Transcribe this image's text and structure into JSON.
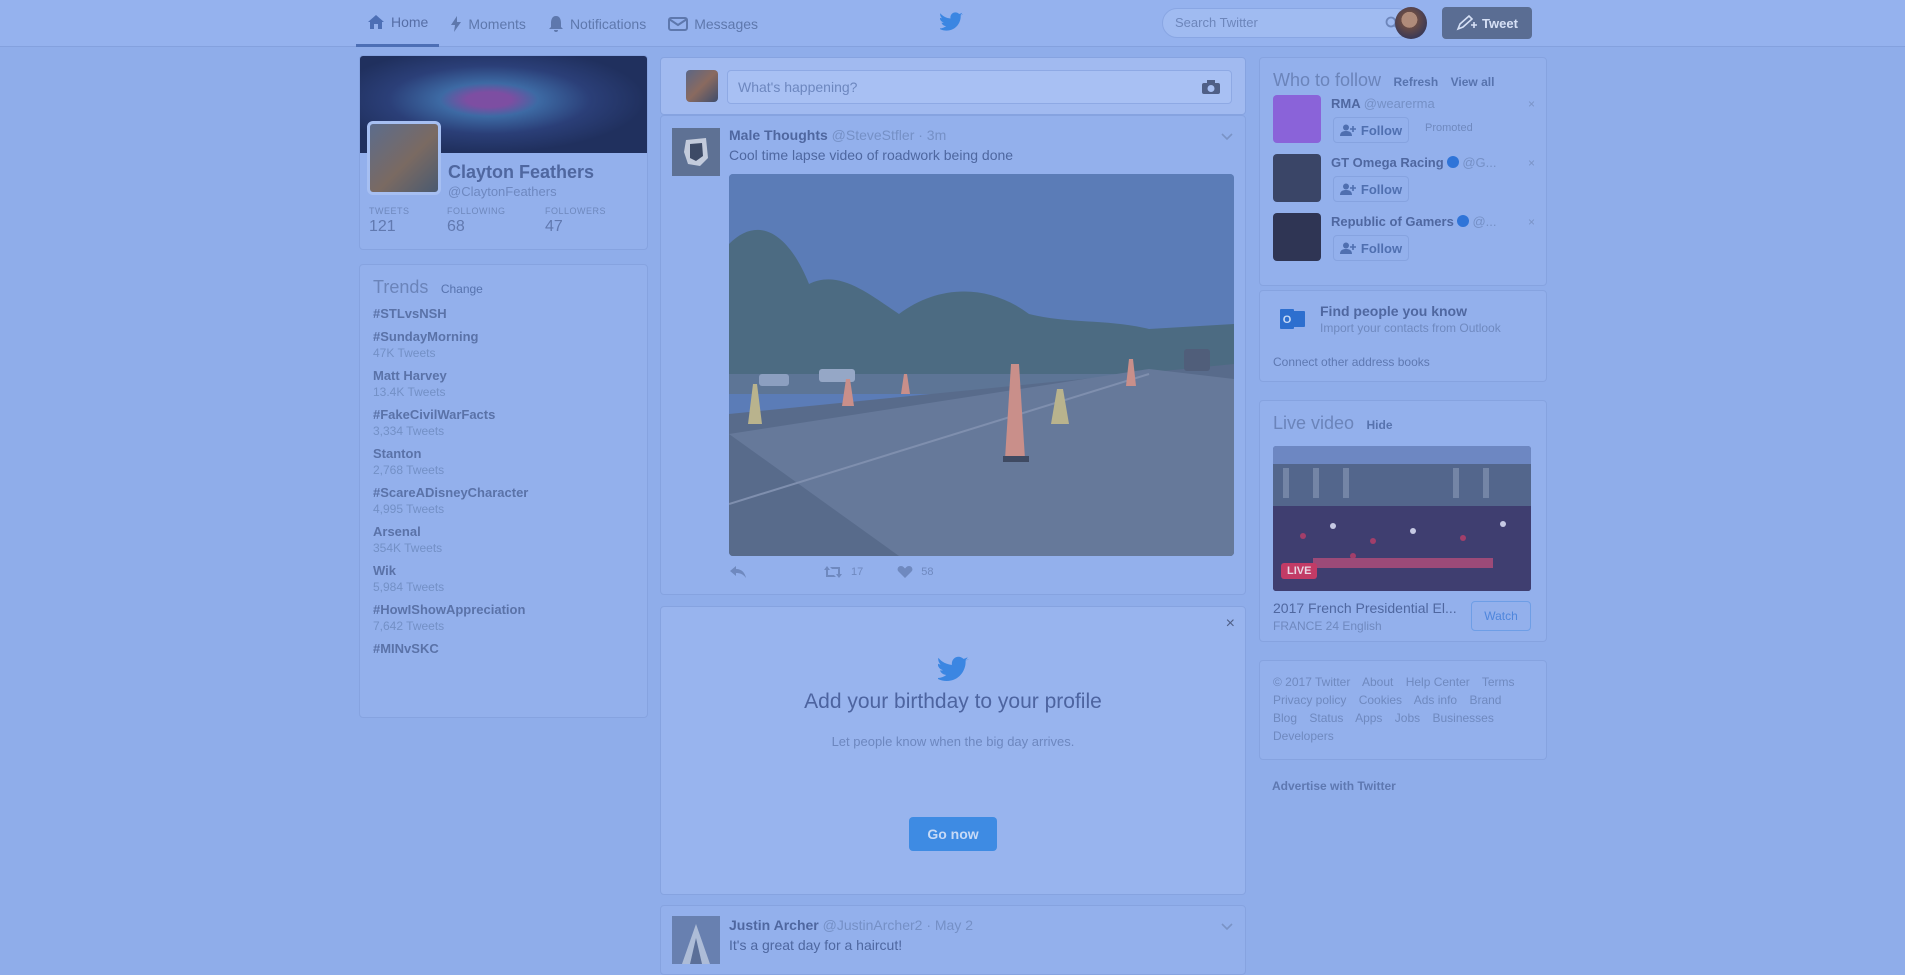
{
  "nav": {
    "items": [
      {
        "label": "Home",
        "icon": "home-icon"
      },
      {
        "label": "Moments",
        "icon": "lightning-icon"
      },
      {
        "label": "Notifications",
        "icon": "bell-icon"
      },
      {
        "label": "Messages",
        "icon": "envelope-icon"
      }
    ],
    "search_placeholder": "Search Twitter",
    "tweet_button": "Tweet"
  },
  "profile": {
    "name": "Clayton Feathers",
    "handle": "@ClaytonFeathers",
    "stats": [
      {
        "label": "TWEETS",
        "value": "121"
      },
      {
        "label": "FOLLOWING",
        "value": "68"
      },
      {
        "label": "FOLLOWERS",
        "value": "47"
      }
    ]
  },
  "trends": {
    "title": "Trends",
    "change_label": "Change",
    "items": [
      {
        "name": "#STLvsNSH",
        "count": ""
      },
      {
        "name": "#SundayMorning",
        "count": "47K Tweets"
      },
      {
        "name": "Matt Harvey",
        "count": "13.4K Tweets"
      },
      {
        "name": "#FakeCivilWarFacts",
        "count": "3,334 Tweets"
      },
      {
        "name": "Stanton",
        "count": "2,768 Tweets"
      },
      {
        "name": "#ScareADisneyCharacter",
        "count": "4,995 Tweets"
      },
      {
        "name": "Arsenal",
        "count": "354K Tweets"
      },
      {
        "name": "Wik",
        "count": "5,984 Tweets"
      },
      {
        "name": "#HowIShowAppreciation",
        "count": "7,642 Tweets"
      },
      {
        "name": "#MINvSKC",
        "count": ""
      }
    ]
  },
  "compose": {
    "placeholder": "What's happening?"
  },
  "tweet1": {
    "name": "Male Thoughts",
    "handle": "@SteveStfler",
    "time": "· 3m",
    "text": "Cool time lapse video of roadwork being done",
    "retweets": "17",
    "likes": "58"
  },
  "birthday": {
    "title": "Add your birthday to your profile",
    "subtitle": "Let people know when the big day arrives.",
    "button": "Go now",
    "close": "×"
  },
  "tweet2": {
    "name": "Justin Archer",
    "handle": "@JustinArcher2",
    "time": "· May 2",
    "text": "It's a great day for a haircut!"
  },
  "who": {
    "title": "Who to follow",
    "refresh": "Refresh",
    "view_all": "View all",
    "follow_label": "Follow",
    "items": [
      {
        "name": "RMA",
        "handle": "@wearerma",
        "promoted": "Promoted",
        "verified": false,
        "color": "#8a63d9"
      },
      {
        "name": "GT Omega Racing",
        "handle": "@G...",
        "promoted": "",
        "verified": true,
        "color": "#3a4567"
      },
      {
        "name": "Republic of Gamers",
        "handle": "@...",
        "promoted": "",
        "verified": true,
        "color": "#2f3554"
      }
    ]
  },
  "find": {
    "title": "Find people you know",
    "subtitle": "Import your contacts from Outlook",
    "link": "Connect other address books"
  },
  "live": {
    "title": "Live video",
    "hide": "Hide",
    "badge": "LIVE",
    "video_title": "2017 French Presidential El...",
    "source": "FRANCE 24 English",
    "watch": "Watch"
  },
  "footer": {
    "links": [
      "© 2017 Twitter",
      "About",
      "Help Center",
      "Terms",
      "Privacy policy",
      "Cookies",
      "Ads info",
      "Brand",
      "Blog",
      "Status",
      "Apps",
      "Jobs",
      "Businesses",
      "Developers"
    ],
    "advertise": "Advertise with Twitter"
  }
}
